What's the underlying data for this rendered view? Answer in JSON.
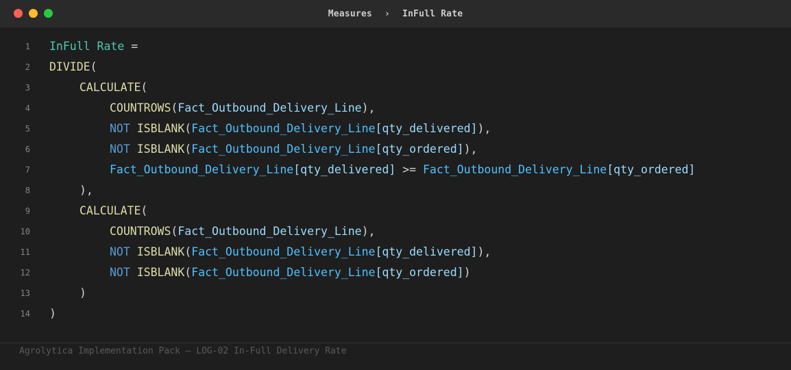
{
  "window": {
    "title_left": "Measures",
    "title_separator": "›",
    "title_right": "InFull Rate",
    "traffic_lights": {
      "close": "#ff5f57",
      "minimize": "#febc2e",
      "maximize": "#28c840"
    }
  },
  "colors": {
    "background": "#1e1e1e",
    "measure": "#4ec9b0",
    "function": "#dcdcaa",
    "keyword": "#569cd6",
    "table": "#4fc1ff",
    "column": "#9cdcfe",
    "punctuation": "#d4d4d4"
  },
  "editor": {
    "lines": [
      {
        "num": "1",
        "indent": 0,
        "tokens": [
          {
            "t": "InFull Rate",
            "k": "meas"
          },
          {
            "t": " =",
            "k": "op"
          }
        ]
      },
      {
        "num": "2",
        "indent": 0,
        "tokens": [
          {
            "t": "DIVIDE",
            "k": "fn"
          },
          {
            "t": "(",
            "k": "op"
          }
        ]
      },
      {
        "num": "3",
        "indent": 4,
        "tokens": [
          {
            "t": "CALCULATE",
            "k": "fn"
          },
          {
            "t": "(",
            "k": "op"
          }
        ]
      },
      {
        "num": "4",
        "indent": 8,
        "tokens": [
          {
            "t": "COUNTROWS",
            "k": "fn"
          },
          {
            "t": "(",
            "k": "op"
          },
          {
            "t": "Fact_Outbound_Delivery_Line",
            "k": "col"
          },
          {
            "t": "),",
            "k": "op"
          }
        ]
      },
      {
        "num": "5",
        "indent": 8,
        "tokens": [
          {
            "t": "NOT",
            "k": "kw"
          },
          {
            "t": " ",
            "k": "op"
          },
          {
            "t": "ISBLANK",
            "k": "fn"
          },
          {
            "t": "(",
            "k": "op"
          },
          {
            "t": "Fact_Outbound_Delivery_Line",
            "k": "tbl"
          },
          {
            "t": "[qty_delivered]",
            "k": "col"
          },
          {
            "t": "),",
            "k": "op"
          }
        ]
      },
      {
        "num": "6",
        "indent": 8,
        "tokens": [
          {
            "t": "NOT",
            "k": "kw"
          },
          {
            "t": " ",
            "k": "op"
          },
          {
            "t": "ISBLANK",
            "k": "fn"
          },
          {
            "t": "(",
            "k": "op"
          },
          {
            "t": "Fact_Outbound_Delivery_Line",
            "k": "tbl"
          },
          {
            "t": "[qty_ordered]",
            "k": "col"
          },
          {
            "t": "),",
            "k": "op"
          }
        ]
      },
      {
        "num": "7",
        "indent": 8,
        "tokens": [
          {
            "t": "Fact_Outbound_Delivery_Line",
            "k": "tbl"
          },
          {
            "t": "[qty_delivered]",
            "k": "col"
          },
          {
            "t": " >= ",
            "k": "op"
          },
          {
            "t": "Fact_Outbound_Delivery_Line",
            "k": "tbl"
          },
          {
            "t": "[qty_ordered]",
            "k": "col"
          }
        ]
      },
      {
        "num": "8",
        "indent": 4,
        "tokens": [
          {
            "t": "),",
            "k": "op"
          }
        ]
      },
      {
        "num": "9",
        "indent": 4,
        "tokens": [
          {
            "t": "CALCULATE",
            "k": "fn"
          },
          {
            "t": "(",
            "k": "op"
          }
        ]
      },
      {
        "num": "10",
        "indent": 8,
        "tokens": [
          {
            "t": "COUNTROWS",
            "k": "fn"
          },
          {
            "t": "(",
            "k": "op"
          },
          {
            "t": "Fact_Outbound_Delivery_Line",
            "k": "col"
          },
          {
            "t": "),",
            "k": "op"
          }
        ]
      },
      {
        "num": "11",
        "indent": 8,
        "tokens": [
          {
            "t": "NOT",
            "k": "kw"
          },
          {
            "t": " ",
            "k": "op"
          },
          {
            "t": "ISBLANK",
            "k": "fn"
          },
          {
            "t": "(",
            "k": "op"
          },
          {
            "t": "Fact_Outbound_Delivery_Line",
            "k": "tbl"
          },
          {
            "t": "[qty_delivered]",
            "k": "col"
          },
          {
            "t": "),",
            "k": "op"
          }
        ]
      },
      {
        "num": "12",
        "indent": 8,
        "tokens": [
          {
            "t": "NOT",
            "k": "kw"
          },
          {
            "t": " ",
            "k": "op"
          },
          {
            "t": "ISBLANK",
            "k": "fn"
          },
          {
            "t": "(",
            "k": "op"
          },
          {
            "t": "Fact_Outbound_Delivery_Line",
            "k": "tbl"
          },
          {
            "t": "[qty_ordered]",
            "k": "col"
          },
          {
            "t": ")",
            "k": "op"
          }
        ]
      },
      {
        "num": "13",
        "indent": 4,
        "tokens": [
          {
            "t": ")",
            "k": "op"
          }
        ]
      },
      {
        "num": "14",
        "indent": 0,
        "tokens": [
          {
            "t": ")",
            "k": "op"
          }
        ]
      }
    ]
  },
  "footer": {
    "text": "Agrolytica Implementation Pack — LOG-02 In-Full Delivery Rate"
  }
}
